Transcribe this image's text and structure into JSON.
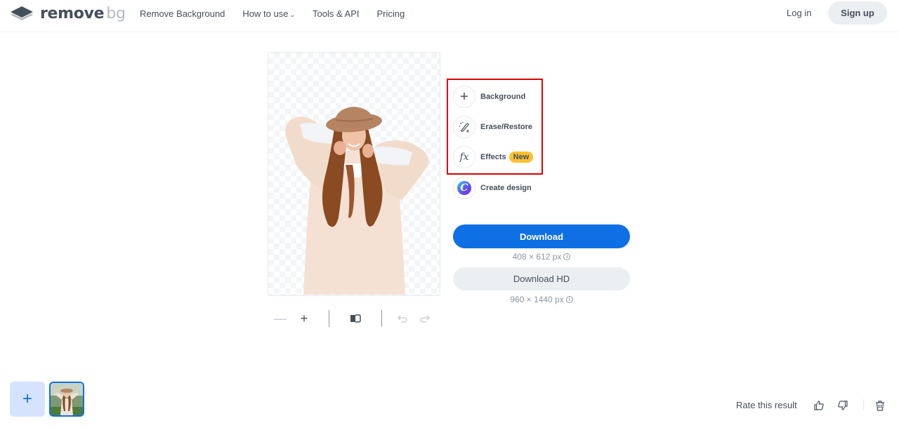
{
  "header": {
    "logo": {
      "icon": "layers-logo-icon",
      "text_main": "remove",
      "text_accent": "bg"
    },
    "nav": [
      {
        "label": "Remove Background",
        "has_dropdown": false
      },
      {
        "label": "How to use",
        "has_dropdown": true
      },
      {
        "label": "Tools & API",
        "has_dropdown": false
      },
      {
        "label": "Pricing",
        "has_dropdown": false
      }
    ],
    "login_label": "Log in",
    "signup_label": "Sign up"
  },
  "editor": {
    "image_alt": "Woman in hat with background removed",
    "toolbar": {
      "zoom_out_icon": "minus-icon",
      "zoom_in_icon": "plus-icon",
      "compare_icon": "compare-icon",
      "undo_icon": "undo-icon",
      "redo_icon": "redo-icon"
    },
    "tools": [
      {
        "label": "Background",
        "icon": "plus-icon"
      },
      {
        "label": "Erase/Restore",
        "icon": "magic-brush-icon"
      },
      {
        "label": "Effects",
        "icon": "fx-icon",
        "badge": "New"
      },
      {
        "label": "Create design",
        "icon": "canva-icon",
        "icon_glyph": "C"
      }
    ],
    "download": {
      "label": "Download",
      "size": "408 × 612 px",
      "info_glyph": "i"
    },
    "download_hd": {
      "label": "Download HD",
      "size": "960 × 1440 px",
      "info_glyph": "i"
    }
  },
  "footer": {
    "add_label": "+",
    "rate_label": "Rate this result"
  },
  "colors": {
    "accent": "#0f70e6",
    "badge": "#fbc02d",
    "highlight": "#e00000",
    "text": "#454f5b",
    "muted": "#8a96a3"
  }
}
